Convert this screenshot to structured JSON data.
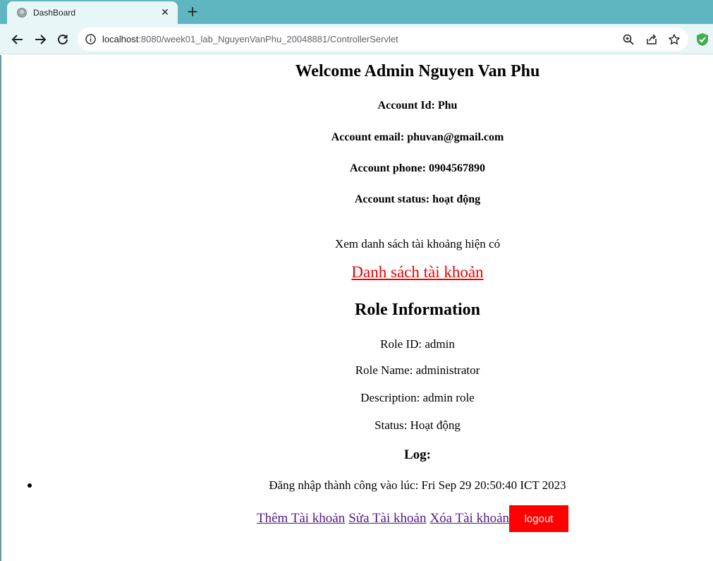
{
  "browser": {
    "tab_title": "DashBoard",
    "tab_close": "✕",
    "new_tab": "+",
    "url_host": "localhost",
    "url_path": ":8080/week01_lab_NguyenVanPhu_20048881/ControllerServlet",
    "icons": [
      "back-arrow-icon",
      "forward-arrow-icon",
      "reload-icon",
      "site-info-icon",
      "zoom-icon",
      "share-icon",
      "bookmark-star-icon",
      "extension-shield-icon"
    ]
  },
  "dashboard": {
    "welcome": "Welcome Admin Nguyen Van Phu",
    "account_id": "Account Id: Phu",
    "account_email": "Account email: phuvan@gmail.com",
    "account_phone": "Account phone: 0904567890",
    "account_status": "Account status: hoạt động",
    "list_note": "Xem danh sách tài khoảng hiện có",
    "list_link": "Danh sách tài khoản"
  },
  "role": {
    "title": "Role Information",
    "id": "Role ID: admin",
    "name": "Role Name: administrator",
    "description": "Description: admin role",
    "status": "Status: Hoạt động"
  },
  "log": {
    "title": "Log:",
    "entries": [
      "Đăng nhập thành công vào lúc: Fri Sep 29 20:50:40 ICT 2023"
    ]
  },
  "actions": {
    "add": "Thêm Tài khoản",
    "edit": "Sửa Tài khoản",
    "delete": "Xóa Tài khoản",
    "logout": "logout"
  },
  "colors": {
    "tabstrip": "#5fb5c0",
    "toolbar": "#e9f6f7",
    "link_red": "#ee0000",
    "visited_link": "#551a8b",
    "logout_bg": "#ff0000"
  }
}
